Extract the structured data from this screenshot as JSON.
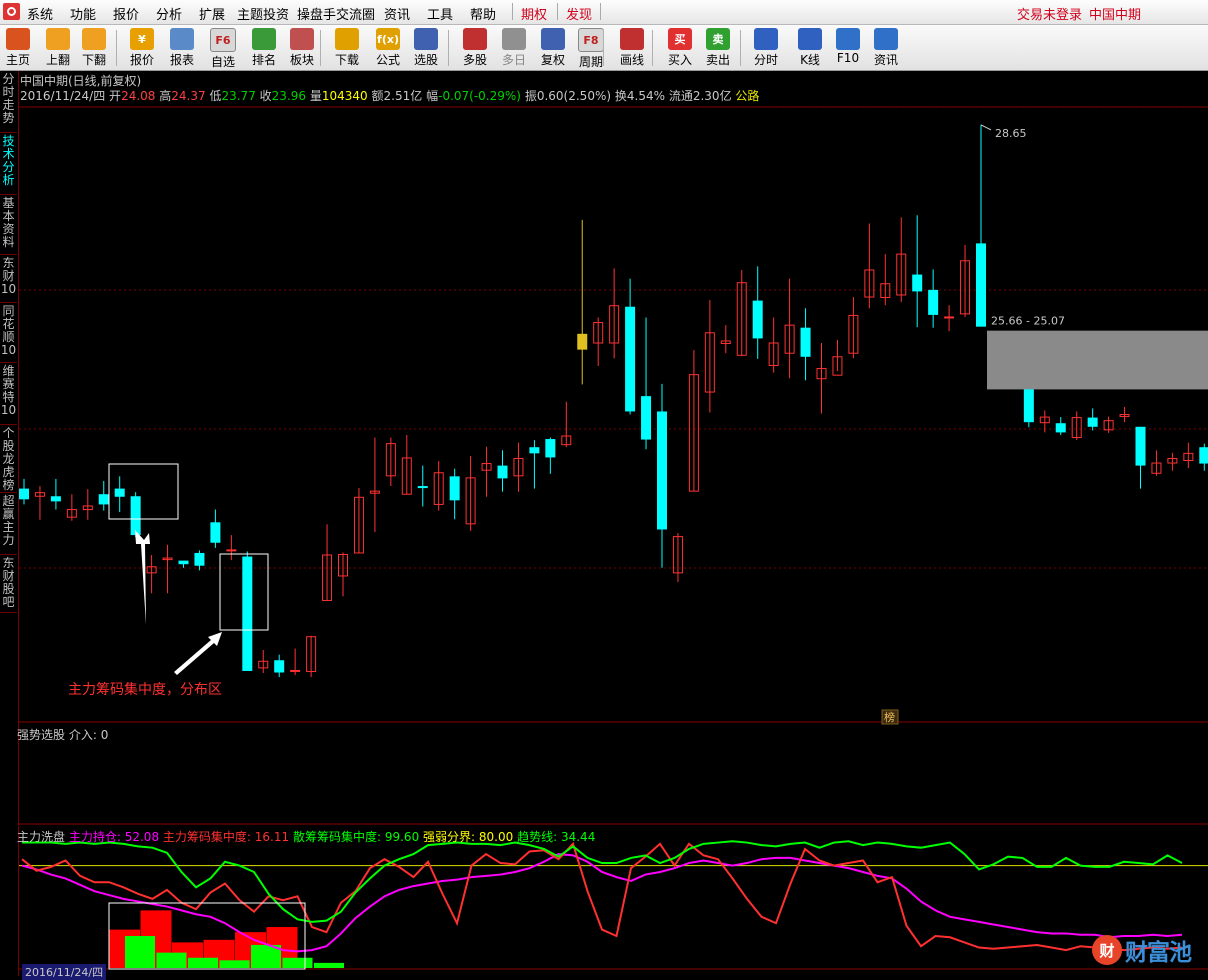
{
  "menu": {
    "items": [
      "系统",
      "功能",
      "报价",
      "分析",
      "扩展",
      "主题投资",
      "操盘手交流圈",
      "资讯",
      "工具",
      "帮助"
    ],
    "qiquan": "期权",
    "faxian": "发现",
    "login_status": "交易未登录",
    "broker": "中国中期"
  },
  "toolbar": [
    {
      "label": "主页",
      "icon": "home-icon",
      "color": "#d9531e"
    },
    {
      "label": "上翻",
      "icon": "arrow-up-icon",
      "color": "#f0a020"
    },
    {
      "label": "下翻",
      "icon": "arrow-down-icon",
      "color": "#f0a020"
    },
    {
      "label": "报价",
      "icon": "yen-icon",
      "color": "#e8a000",
      "glyph": "¥"
    },
    {
      "label": "报表",
      "icon": "report-icon",
      "color": "#5a8ac8"
    },
    {
      "label": "自选",
      "icon": "f6-icon",
      "color": "#d8d8d8",
      "glyph": "F6"
    },
    {
      "label": "排名",
      "icon": "rank-icon",
      "color": "#3a9a3a"
    },
    {
      "label": "板块",
      "icon": "blocks-icon",
      "color": "#c05050"
    },
    {
      "label": "下载",
      "icon": "download-icon",
      "color": "#e0a000"
    },
    {
      "label": "公式",
      "icon": "formula-icon",
      "color": "#e0a000",
      "glyph": "f(x)"
    },
    {
      "label": "选股",
      "icon": "select-stock-icon",
      "color": "#4060b0"
    },
    {
      "label": "多股",
      "icon": "multi-stock-icon",
      "color": "#c03030"
    },
    {
      "label": "多日",
      "icon": "clock-icon",
      "color": "#909090"
    },
    {
      "label": "复权",
      "icon": "restore-icon",
      "color": "#4060b0"
    },
    {
      "label": "周期",
      "icon": "f8-icon",
      "color": "#d8d8d8",
      "glyph": "F8"
    },
    {
      "label": "画线",
      "icon": "draw-line-icon",
      "color": "#c03030"
    },
    {
      "label": "买入",
      "icon": "buy-icon",
      "color": "#e03030",
      "glyph": "买"
    },
    {
      "label": "卖出",
      "icon": "sell-icon",
      "color": "#30a030",
      "glyph": "卖"
    },
    {
      "label": "分时",
      "icon": "intraday-icon",
      "color": "#3060c0"
    },
    {
      "label": "K线",
      "icon": "kline-icon",
      "color": "#3060c0"
    },
    {
      "label": "F10",
      "icon": "f10-icon",
      "color": "#3070c8"
    },
    {
      "label": "资讯",
      "icon": "news-icon",
      "color": "#3070c8"
    }
  ],
  "left_tabs": [
    "分时走势",
    "技术分析",
    "基本资料",
    "东财10",
    "同花顺10",
    "维赛特10",
    "个股龙虎榜",
    "超赢主力",
    "东财股吧"
  ],
  "stock": {
    "title": "中国中期(日线,前复权)",
    "date": "2016/11/24/四",
    "open_label": "开",
    "open": "24.08",
    "high_label": "高",
    "high": "24.37",
    "low_label": "低",
    "low": "23.77",
    "close_label": "收",
    "close": "23.96",
    "vol_label": "量",
    "vol": "104340",
    "amt_label": "额",
    "amt": "2.51亿",
    "chg_label": "幅",
    "chg": "-0.07(-0.29%)",
    "amp_label": "振",
    "amp": "0.60(2.50%)",
    "turn_label": "换",
    "turn": "4.54%",
    "float_label": "流通",
    "float": "2.30亿",
    "tag": "公路"
  },
  "chart_data": [
    {
      "type": "candlestick",
      "ylim": [
        17.0,
        29.0
      ],
      "annotations": {
        "high_label": "28.65",
        "range_label": "25.66 - 25.07",
        "marker": "榜",
        "callout": "主力筹码集中度，分布区"
      },
      "candles": [
        [
          21.53,
          21.32,
          21.72,
          21.22
        ],
        [
          21.38,
          21.45,
          21.58,
          20.92
        ],
        [
          21.38,
          21.28,
          21.72,
          21.12
        ],
        [
          20.97,
          21.12,
          21.42,
          20.9
        ],
        [
          21.12,
          21.19,
          21.52,
          20.92
        ],
        [
          21.42,
          21.22,
          21.68,
          21.1
        ],
        [
          21.53,
          21.37,
          21.77,
          21.07
        ],
        [
          21.38,
          20.62,
          21.46,
          20.58
        ],
        [
          19.88,
          20.0,
          20.23,
          19.48
        ],
        [
          20.14,
          20.17,
          20.43,
          19.48
        ],
        [
          20.12,
          20.05,
          20.08,
          19.98
        ],
        [
          20.27,
          20.02,
          20.32,
          19.93
        ],
        [
          20.87,
          20.47,
          21.12,
          20.37
        ],
        [
          20.32,
          20.33,
          20.62,
          20.13
        ],
        [
          20.2,
          17.96,
          20.3,
          17.96
        ],
        [
          18.02,
          18.15,
          18.37,
          17.92
        ],
        [
          18.17,
          17.93,
          18.28,
          17.84
        ],
        [
          17.96,
          17.97,
          18.4,
          17.88
        ],
        [
          17.95,
          18.63,
          18.65,
          17.84
        ],
        [
          19.34,
          20.23,
          20.83,
          19.33
        ],
        [
          19.82,
          20.24,
          20.28,
          19.42
        ],
        [
          20.27,
          21.36,
          21.54,
          20.27
        ],
        [
          21.44,
          21.48,
          22.53,
          20.68
        ],
        [
          21.78,
          22.41,
          22.53,
          21.58
        ],
        [
          21.42,
          22.13,
          22.58,
          21.42
        ],
        [
          21.58,
          21.54,
          21.98,
          21.18
        ],
        [
          21.22,
          21.84,
          22.07,
          21.1
        ],
        [
          21.77,
          21.3,
          21.92,
          20.93
        ],
        [
          20.84,
          21.74,
          22.17,
          20.7
        ],
        [
          21.89,
          22.02,
          22.35,
          21.37
        ],
        [
          21.98,
          21.73,
          22.28,
          21.47
        ],
        [
          21.78,
          22.12,
          22.43,
          21.47
        ],
        [
          22.34,
          22.22,
          22.48,
          21.53
        ],
        [
          22.5,
          22.14,
          22.53,
          21.82
        ],
        [
          22.39,
          22.56,
          23.23,
          22.34
        ],
        [
          24.56,
          24.25,
          26.79,
          23.57
        ],
        [
          24.38,
          24.78,
          24.88,
          23.93
        ],
        [
          24.38,
          25.11,
          25.84,
          24.08
        ],
        [
          25.09,
          23.04,
          25.64,
          22.98
        ],
        [
          23.34,
          22.49,
          24.88,
          22.3
        ],
        [
          23.04,
          20.73,
          23.58,
          19.98
        ],
        [
          19.88,
          20.59,
          20.66,
          19.7
        ],
        [
          21.48,
          23.76,
          24.24,
          21.48
        ],
        [
          23.42,
          24.58,
          25.22,
          23.02
        ],
        [
          24.37,
          24.42,
          24.73,
          24.18
        ],
        [
          24.14,
          25.56,
          25.81,
          24.12
        ],
        [
          25.21,
          24.47,
          25.88,
          24.07
        ],
        [
          23.94,
          24.38,
          24.88,
          23.8
        ],
        [
          24.18,
          24.73,
          25.64,
          23.69
        ],
        [
          24.68,
          24.11,
          25.06,
          23.65
        ],
        [
          23.68,
          23.88,
          24.38,
          23.0
        ],
        [
          23.75,
          24.11,
          24.44,
          23.83
        ],
        [
          24.18,
          24.92,
          25.28,
          24.08
        ],
        [
          25.28,
          25.81,
          26.72,
          25.06
        ],
        [
          25.27,
          25.54,
          26.12,
          25.12
        ],
        [
          25.32,
          26.12,
          26.84,
          25.18
        ],
        [
          25.72,
          25.39,
          26.88,
          24.69
        ],
        [
          25.42,
          24.93,
          25.82,
          24.68
        ],
        [
          24.87,
          24.89,
          25.12,
          24.61
        ],
        [
          24.95,
          25.99,
          26.3,
          24.89
        ],
        [
          26.33,
          24.7,
          28.65,
          24.7
        ],
        [
          24.07,
          23.97,
          24.43,
          23.76
        ],
        [
          24.08,
          23.96,
          24.37,
          23.77
        ],
        [
          23.88,
          22.83,
          23.88,
          22.73
        ],
        [
          22.82,
          22.93,
          23.06,
          22.63
        ],
        [
          22.81,
          22.63,
          22.93,
          22.58
        ],
        [
          22.53,
          22.92,
          23.04,
          22.48
        ],
        [
          22.92,
          22.74,
          23.1,
          22.67
        ],
        [
          22.68,
          22.86,
          22.94,
          22.62
        ],
        [
          22.94,
          22.98,
          23.13,
          22.83
        ],
        [
          22.74,
          21.98,
          22.74,
          21.53
        ],
        [
          21.83,
          22.03,
          22.28,
          21.78
        ],
        [
          22.03,
          22.12,
          22.23,
          21.88
        ],
        [
          22.08,
          22.22,
          22.43,
          21.93
        ],
        [
          22.34,
          22.02,
          22.41,
          21.88
        ],
        [
          21.98,
          21.39,
          22.11,
          21.34
        ],
        [
          21.38,
          21.43,
          21.73,
          20.98
        ],
        [
          21.43,
          22.31,
          22.33,
          21.43
        ],
        [
          21.98,
          22.04,
          22.18,
          21.83
        ],
        [
          22.08,
          22.38,
          22.73,
          22.03
        ],
        [
          22.48,
          22.06,
          22.58,
          21.78
        ]
      ]
    },
    {
      "type": "line",
      "title": "强势选股",
      "series": [
        {
          "name": "介入",
          "values": [
            0.0
          ]
        }
      ]
    },
    {
      "type": "line",
      "title": "主力洗盘",
      "ylim": [
        0,
        100
      ],
      "series": [
        {
          "name": "主力持仓",
          "current": "52.08",
          "color": "#ff00ff",
          "values": [
            80,
            77,
            73,
            70,
            65,
            60,
            57,
            54,
            52,
            50,
            48,
            45,
            42,
            40,
            35,
            28,
            22,
            18,
            14,
            13,
            14,
            17,
            27,
            39,
            48,
            56,
            61,
            64,
            66,
            68,
            69,
            71,
            72,
            73,
            75,
            78,
            83,
            89,
            88,
            83,
            75,
            71,
            68,
            73,
            75,
            78,
            82,
            84,
            82,
            80,
            82,
            85,
            86,
            86,
            84,
            82,
            80,
            78,
            75,
            72,
            70,
            62,
            52,
            45,
            40,
            38,
            36,
            34,
            32,
            30,
            28,
            27,
            27,
            26,
            26,
            24,
            25,
            25,
            26,
            25,
            26
          ]
        },
        {
          "name": "主力筹码集中度",
          "current": "16.11",
          "color": "#ff3030",
          "values": [
            85,
            76,
            79,
            84,
            72,
            67,
            67,
            63,
            58,
            54,
            61,
            51,
            46,
            59,
            66,
            53,
            44,
            56,
            53,
            56,
            32,
            28,
            51,
            60,
            78,
            85,
            79,
            71,
            83,
            58,
            35,
            80,
            89,
            82,
            81,
            91,
            92,
            85,
            97,
            60,
            30,
            25,
            78,
            87,
            97,
            80,
            97,
            88,
            85,
            70,
            54,
            40,
            35,
            66,
            93,
            84,
            80,
            82,
            84,
            67,
            71,
            33,
            17,
            25,
            24,
            20,
            16,
            15,
            16,
            17,
            18,
            16,
            14,
            17,
            16,
            15,
            14,
            15,
            16,
            15,
            16
          ]
        },
        {
          "name": "散筹筹码集中度",
          "current": "99.60",
          "color": "#00ff00",
          "values": [
            98,
            98,
            98,
            97,
            98,
            97,
            98,
            97,
            95,
            94,
            90,
            75,
            63,
            70,
            83,
            80,
            75,
            58,
            46,
            38,
            36,
            37,
            44,
            59,
            70,
            80,
            85,
            89,
            96,
            97,
            98,
            97,
            97,
            96,
            98,
            96,
            93,
            87,
            95,
            86,
            82,
            82,
            86,
            88,
            82,
            86,
            93,
            97,
            98,
            99,
            98,
            96,
            95,
            97,
            98,
            94,
            98,
            99,
            96,
            98,
            97,
            95,
            94,
            96,
            98,
            89,
            77,
            81,
            87,
            86,
            79,
            79,
            86,
            80,
            79,
            79,
            83,
            82,
            81,
            88,
            82
          ]
        },
        {
          "name": "强弱分界",
          "current": "80.00",
          "color": "#ffff00",
          "values": [
            80
          ]
        },
        {
          "name": "趋势线",
          "current": "34.44",
          "color": "#00ff00"
        }
      ],
      "histogram": [
        {
          "color": "#ff0000",
          "values": [
            [
              0,
              30
            ],
            [
              1,
              45
            ],
            [
              2,
              20
            ],
            [
              3,
              22
            ],
            [
              4,
              28
            ],
            [
              5,
              32
            ]
          ]
        },
        {
          "color": "#00ff00",
          "values": [
            [
              0,
              25
            ],
            [
              1,
              12
            ],
            [
              2,
              8
            ],
            [
              3,
              6
            ],
            [
              4,
              18
            ],
            [
              5,
              8
            ],
            [
              6,
              4
            ]
          ]
        }
      ]
    }
  ],
  "bottom_date": "2016/11/24/四",
  "watermark": {
    "circle": "财",
    "text": "财富池"
  }
}
